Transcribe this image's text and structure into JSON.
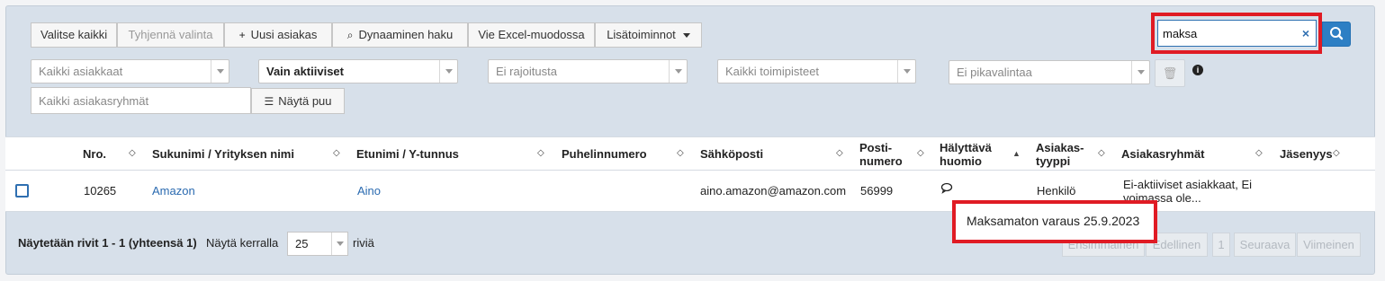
{
  "toolbar": {
    "select_all": "Valitse kaikki",
    "clear_selection": "Tyhjennä valinta",
    "new_customer": "Uusi asiakas",
    "dynamic_search": "Dynaaminen haku",
    "export_excel": "Vie Excel-muodossa",
    "more_actions": "Lisätoiminnot"
  },
  "filters": {
    "customers": "Kaikki asiakkaat",
    "active": "Vain aktiiviset",
    "restriction": "Ei rajoitusta",
    "offices": "Kaikki toimipisteet",
    "quick_select": "Ei pikavalintaa",
    "groups_placeholder": "Kaikki asiakasryhmät",
    "show_tree": "Näytä puu"
  },
  "search": {
    "value": "maksa",
    "clear": "×"
  },
  "table": {
    "headers": {
      "nro": "Nro.",
      "surname": "Sukunimi / Yrityksen nimi",
      "firstname": "Etunimi / Y-tunnus",
      "phone": "Puhelinnumero",
      "email": "Sähköposti",
      "postal_1": "Posti-",
      "postal_2": "numero",
      "alert_1": "Hälyttävä",
      "alert_2": "huomio",
      "type_1": "Asiakas-",
      "type_2": "tyyppi",
      "groups": "Asiakasryhmät",
      "membership": "Jäsenyys"
    },
    "row": {
      "nro": "10265",
      "surname": "Amazon",
      "firstname": "Aino",
      "email": "aino.amazon@amazon.com",
      "postal": "56999",
      "type": "Henkilö",
      "groups_1": "Ei-aktiiviset asiakkaat, Ei",
      "groups_2": "voimassa ole..."
    }
  },
  "tooltip": {
    "text": "Maksamaton varaus 25.9.2023"
  },
  "footer": {
    "showing": "Näytetään rivit 1 - 1 (yhteensä 1)",
    "per_page_label": "Näytä kerralla",
    "per_page": "25",
    "rows_suffix": "riviä",
    "first": "Ensimmäinen",
    "previous": "Edellinen",
    "page": "1",
    "next": "Seuraava",
    "last": "Viimeinen"
  }
}
